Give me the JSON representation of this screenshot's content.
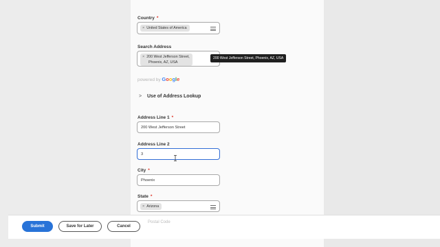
{
  "form": {
    "country": {
      "label": "Country",
      "required_mark": "*",
      "chip": "United States of America",
      "chip_remove": "×"
    },
    "search_address": {
      "label": "Search Address",
      "chip_line1": "200 West Jefferson Street,",
      "chip_line2": "Phoenix, AZ, USA",
      "chip_remove": "×",
      "tooltip": "200 West Jefferson Street, Phoenix, AZ, USA"
    },
    "powered_by": "powered by",
    "powered_brand": "Google",
    "lookup": {
      "chevron": ">",
      "label": "Use of Address Lookup"
    },
    "address_line1": {
      "label": "Address Line 1",
      "required_mark": "*",
      "value": "200 West Jefferson Street"
    },
    "address_line2": {
      "label": "Address Line 2",
      "value": "3"
    },
    "city": {
      "label": "City",
      "required_mark": "*",
      "value": "Phoenix"
    },
    "state": {
      "label": "State",
      "required_mark": "*",
      "chip": "Arizona",
      "chip_remove": "×"
    },
    "partially_hidden_label": "Postal Code"
  },
  "footer": {
    "submit": "Submit",
    "save_for_later": "Save for Later",
    "cancel": "Cancel"
  },
  "colors": {
    "primary_button": "#2873d8",
    "required": "#de2e21",
    "focus_border": "#2f6cd6"
  },
  "icons": {
    "list": "list-icon",
    "text_cursor": "i-beam-cursor-icon"
  }
}
